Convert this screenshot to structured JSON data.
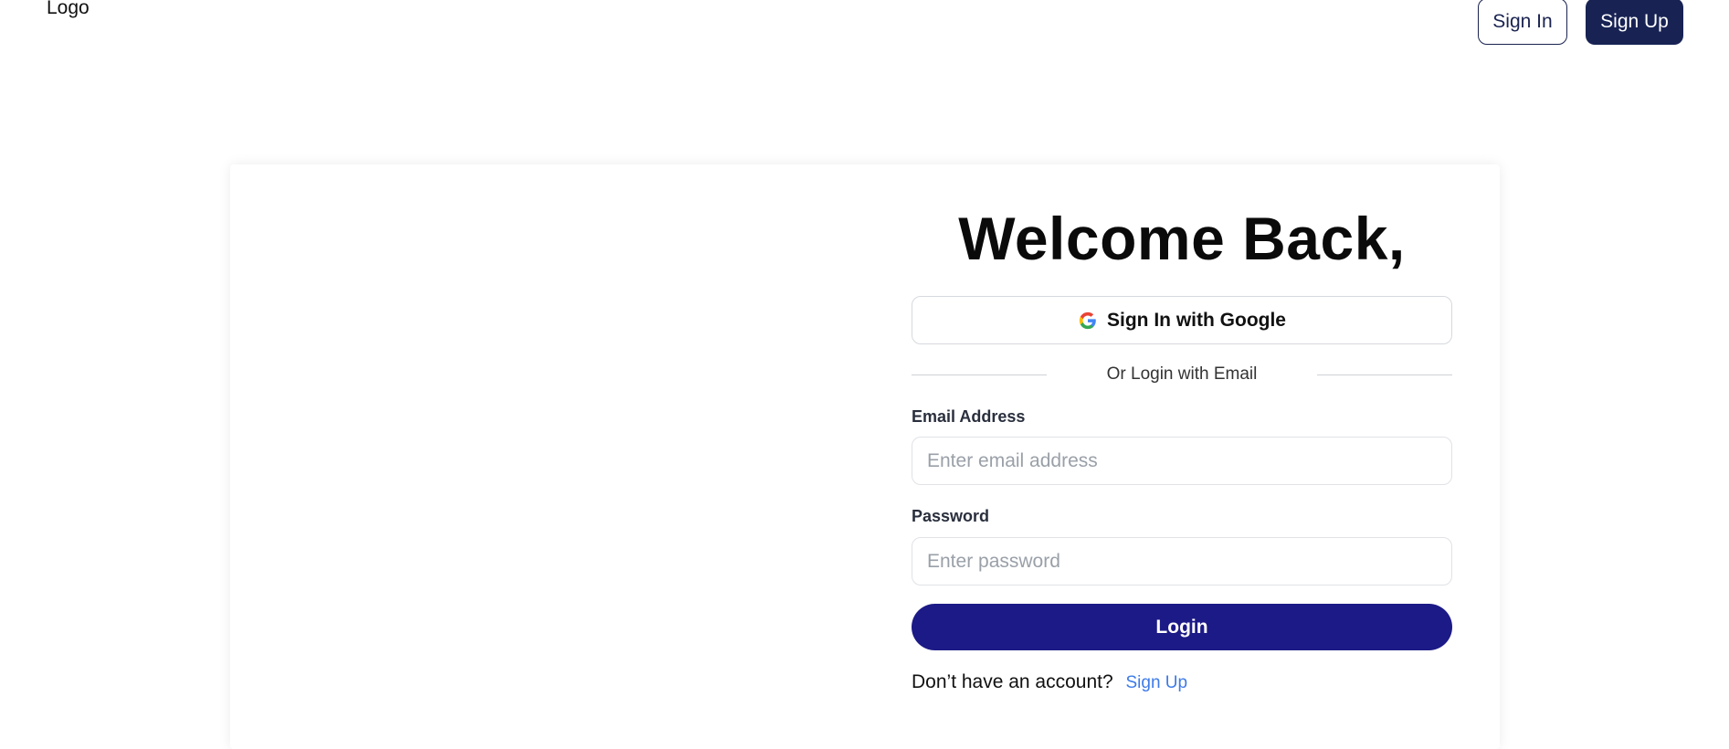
{
  "header": {
    "logo": "Logo",
    "sign_in_label": "Sign In",
    "sign_up_label": "Sign Up"
  },
  "login_form": {
    "title": "Welcome Back,",
    "google_button_label": "Sign In with Google",
    "divider_text": "Or Login with Email",
    "email_label": "Email Address",
    "email_placeholder": "Enter email address",
    "email_value": "",
    "password_label": "Password",
    "password_placeholder": "Enter password",
    "password_value": "",
    "login_button_label": "Login",
    "no_account_text": "Don’t have an account?",
    "signup_link_label": "Sign Up"
  },
  "colors": {
    "primary_navy": "#182354",
    "login_button": "#1c1a86",
    "link_blue": "#3d7be8"
  },
  "icons": {
    "google": "google-icon"
  }
}
